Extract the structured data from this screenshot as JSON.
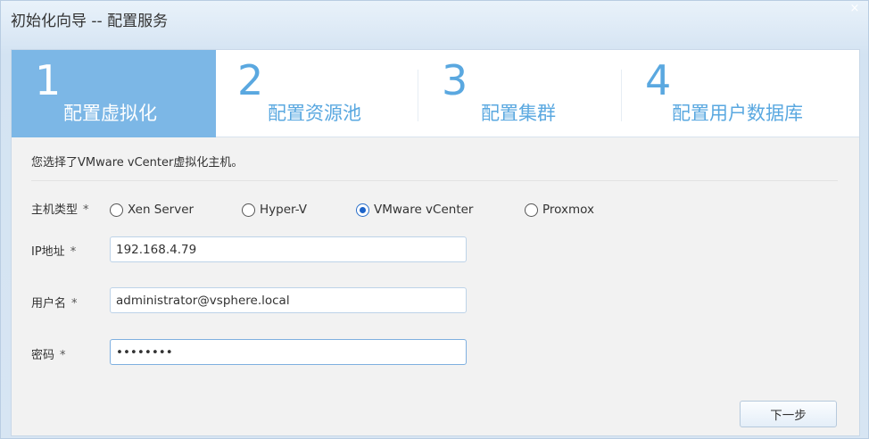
{
  "window": {
    "title": "初始化向导 -- 配置服务",
    "close_glyph": "×"
  },
  "steps": [
    {
      "number": "1",
      "label": "配置虚拟化",
      "active": true
    },
    {
      "number": "2",
      "label": "配置资源池",
      "active": false
    },
    {
      "number": "3",
      "label": "配置集群",
      "active": false
    },
    {
      "number": "4",
      "label": "配置用户数据库",
      "active": false
    }
  ],
  "form": {
    "intro": "您选择了VMware vCenter虚拟化主机。",
    "host_type": {
      "label": "主机类型",
      "required_mark": "*",
      "options": [
        "Xen Server",
        "Hyper-V",
        "VMware vCenter",
        "Proxmox"
      ],
      "selected": "VMware vCenter"
    },
    "ip": {
      "label": "IP地址",
      "required_mark": "*",
      "value": "192.168.4.79"
    },
    "username": {
      "label": "用户名",
      "required_mark": "*",
      "value": "administrator@vsphere.local"
    },
    "password": {
      "label": "密码",
      "required_mark": "*",
      "value": "12345678"
    }
  },
  "actions": {
    "next_label": "下一步"
  },
  "colors": {
    "active_step": "#7cb7e6",
    "inactive_step_text": "#5aa8e0",
    "radio_selected": "#1c63c9"
  }
}
